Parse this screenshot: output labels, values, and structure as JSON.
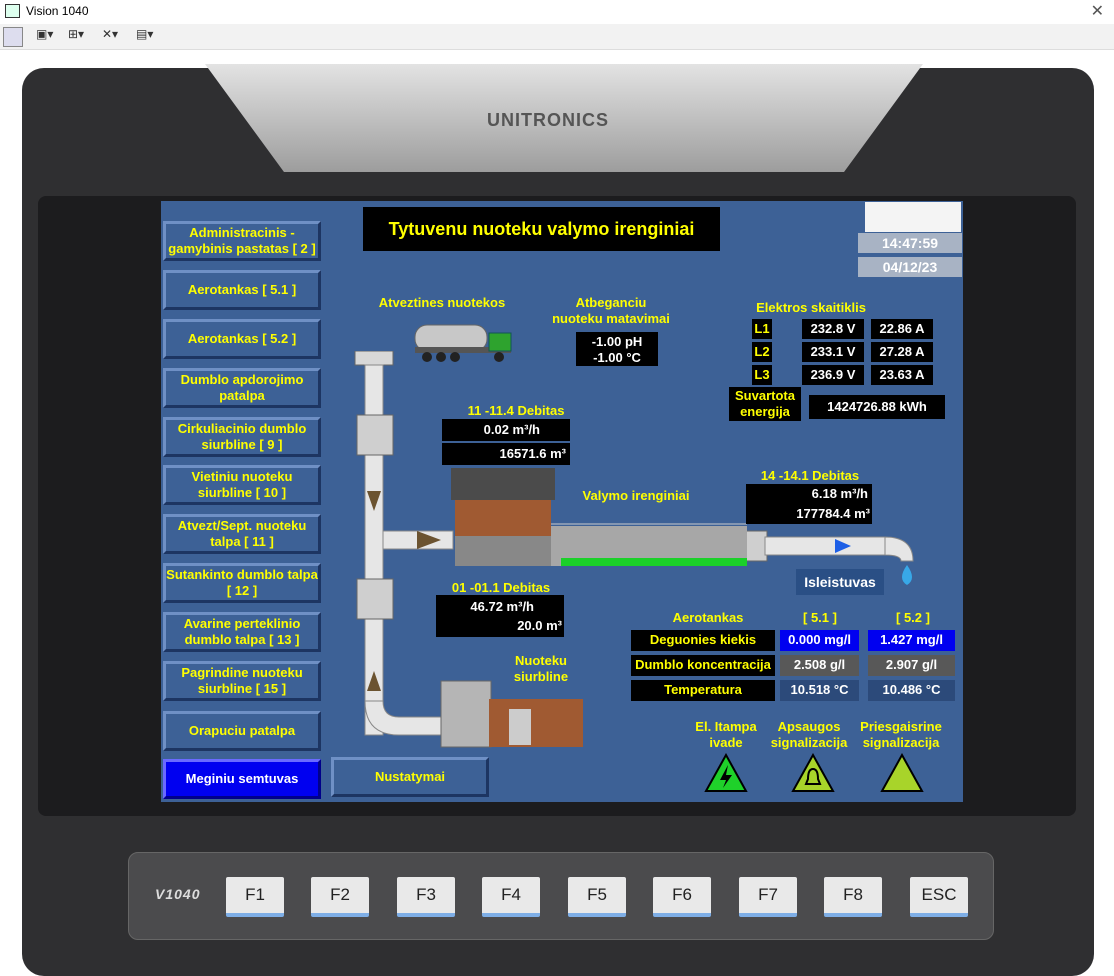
{
  "window": {
    "title": "Vision 1040",
    "close": "✕"
  },
  "device": {
    "brand": "UNITRONICS",
    "model": "V1040"
  },
  "screen": {
    "title": "Tytuvenu nuoteku valymo irenginiai",
    "time": "14:47:59",
    "date": "04/12/23",
    "nav": [
      "Administracinis - gamybinis pastatas [ 2 ]",
      "Aerotankas [ 5.1 ]",
      "Aerotankas [ 5.2 ]",
      "Dumblo apdorojimo patalpa",
      "Cirkuliacinio dumblo siurbline [ 9 ]",
      "Vietiniu nuoteku siurbline [ 10 ]",
      "Atvezt/Sept. nuoteku talpa [ 11 ]",
      "Sutankinto dumblo talpa [ 12 ]",
      "Avarine perteklinio dumblo talpa [ 13 ]",
      "Pagrindine nuoteku siurbline [ 15 ]",
      "Orapuciu patalpa",
      "Meginiu semtuvas"
    ],
    "settings_label": "Nustatymai",
    "atvezt_label": "Atveztines nuotekos",
    "measure_label": "Atbeganciu nuoteku matavimai",
    "ph": "-1.00 pH",
    "temp": "-1.00 °C",
    "meter_label": "Elektros skaitiklis",
    "phases": [
      {
        "l": "L1",
        "v": "232.8 V",
        "a": "22.86 A"
      },
      {
        "l": "L2",
        "v": "233.1 V",
        "a": "27.28 A"
      },
      {
        "l": "L3",
        "v": "236.9 V",
        "a": "23.63 A"
      }
    ],
    "energy_label": "Suvartota energija",
    "energy": "1424726.88 kWh",
    "flow1_label": "11 -11.4 Debitas",
    "flow1_rate": "0.02 m³/h",
    "flow1_total": "16571.6 m³",
    "plant_label": "Valymo irenginiai",
    "flow2_label": "14 -14.1 Debitas",
    "flow2_rate": "6.18 m³/h",
    "flow2_total": "177784.4 m³",
    "outlet_label": "Isleistuvas",
    "flow3_label": "01 -01.1 Debitas",
    "flow3_rate": "46.72 m³/h",
    "flow3_total": "20.0 m³",
    "pump_label": "Nuoteku siurbline",
    "aero": {
      "label": "Aerotankas",
      "c1": "[ 5.1 ]",
      "c2": "[ 5.2 ]",
      "rows": [
        {
          "name": "Deguonies kiekis",
          "v1": "0.000 mg/l",
          "v2": "1.427 mg/l"
        },
        {
          "name": "Dumblo koncentracija",
          "v1": "2.508 g/l",
          "v2": "2.907 g/l"
        },
        {
          "name": "Temperatura",
          "v1": "10.518 °C",
          "v2": "10.486 °C"
        }
      ]
    },
    "alarms": [
      "El. Itampa ivade",
      "Apsaugos signalizacija",
      "Priesgaisrine signalizacija"
    ]
  },
  "keys": [
    "F1",
    "F2",
    "F3",
    "F4",
    "F5",
    "F6",
    "F7",
    "F8",
    "ESC"
  ],
  "colors": {
    "screen": "#3d6196",
    "label": "#ffff00",
    "active": "#0000f0"
  }
}
